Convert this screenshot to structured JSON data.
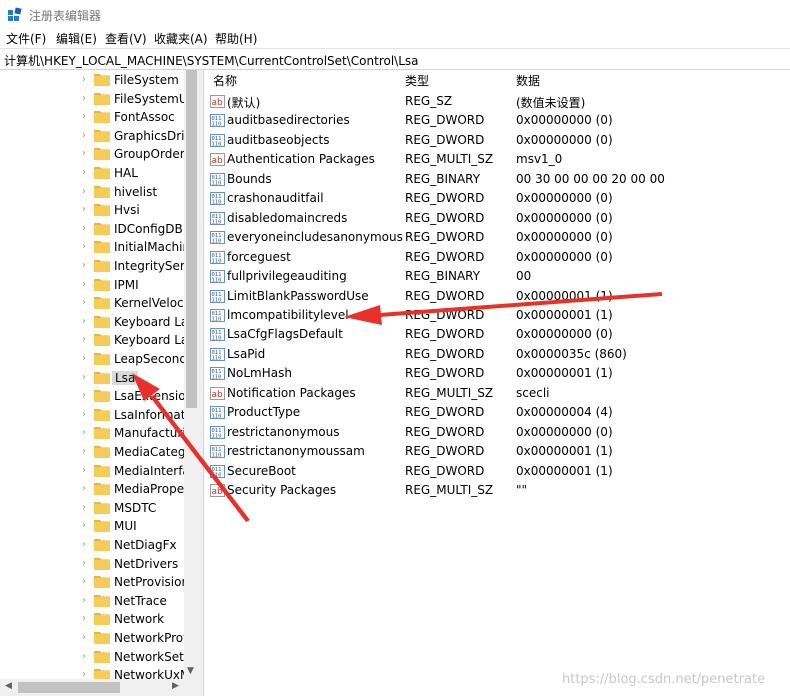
{
  "window": {
    "title": "注册表编辑器"
  },
  "menu": [
    "文件(F)",
    "编辑(E)",
    "查看(V)",
    "收藏夹(A)",
    "帮助(H)"
  ],
  "address": "计算机\\HKEY_LOCAL_MACHINE\\SYSTEM\\CurrentControlSet\\Control\\Lsa",
  "tree": {
    "items": [
      "FileSystem",
      "FileSystemUti",
      "FontAssoc",
      "GraphicsDrive",
      "GroupOrderL",
      "HAL",
      "hivelist",
      "Hvsi",
      "IDConfigDB",
      "InitialMachine",
      "IntegrityServi",
      "IPMI",
      "KernelVelocit",
      "Keyboard Lay",
      "Keyboard Lay",
      "LeapSecondI",
      "Lsa",
      "LsaExtension",
      "LsaInformati",
      "Manufacturi",
      "MediaCatego",
      "MediaInterfa",
      "MediaPropert",
      "MSDTC",
      "MUI",
      "NetDiagFx",
      "NetDrivers",
      "NetProvision",
      "NetTrace",
      "Network",
      "NetworkProv",
      "NetworkSetu",
      "NetworkUxM"
    ],
    "selected": "Lsa"
  },
  "columns": {
    "name": "名称",
    "type": "类型",
    "data": "数据"
  },
  "values": [
    {
      "name": "(默认)",
      "type": "REG_SZ",
      "data": "(数值未设置)",
      "icon": "string-value-icon"
    },
    {
      "name": "auditbasedirectories",
      "type": "REG_DWORD",
      "data": "0x00000000 (0)",
      "icon": "binary-value-icon"
    },
    {
      "name": "auditbaseobjects",
      "type": "REG_DWORD",
      "data": "0x00000000 (0)",
      "icon": "binary-value-icon"
    },
    {
      "name": "Authentication Packages",
      "type": "REG_MULTI_SZ",
      "data": "msv1_0",
      "icon": "string-value-icon"
    },
    {
      "name": "Bounds",
      "type": "REG_BINARY",
      "data": "00 30 00 00 00 20 00 00",
      "icon": "binary-value-icon"
    },
    {
      "name": "crashonauditfail",
      "type": "REG_DWORD",
      "data": "0x00000000 (0)",
      "icon": "binary-value-icon"
    },
    {
      "name": "disabledomaincreds",
      "type": "REG_DWORD",
      "data": "0x00000000 (0)",
      "icon": "binary-value-icon"
    },
    {
      "name": "everyoneincludesanonymous",
      "type": "REG_DWORD",
      "data": "0x00000000 (0)",
      "icon": "binary-value-icon"
    },
    {
      "name": "forceguest",
      "type": "REG_DWORD",
      "data": "0x00000000 (0)",
      "icon": "binary-value-icon"
    },
    {
      "name": "fullprivilegeauditing",
      "type": "REG_BINARY",
      "data": "00",
      "icon": "binary-value-icon"
    },
    {
      "name": "LimitBlankPasswordUse",
      "type": "REG_DWORD",
      "data": "0x00000001 (1)",
      "icon": "binary-value-icon"
    },
    {
      "name": "lmcompatibilitylevel",
      "type": "REG_DWORD",
      "data": "0x00000001 (1)",
      "icon": "binary-value-icon"
    },
    {
      "name": "LsaCfgFlagsDefault",
      "type": "REG_DWORD",
      "data": "0x00000000 (0)",
      "icon": "binary-value-icon"
    },
    {
      "name": "LsaPid",
      "type": "REG_DWORD",
      "data": "0x0000035c (860)",
      "icon": "binary-value-icon"
    },
    {
      "name": "NoLmHash",
      "type": "REG_DWORD",
      "data": "0x00000001 (1)",
      "icon": "binary-value-icon"
    },
    {
      "name": "Notification Packages",
      "type": "REG_MULTI_SZ",
      "data": "scecli",
      "icon": "string-value-icon"
    },
    {
      "name": "ProductType",
      "type": "REG_DWORD",
      "data": "0x00000004 (4)",
      "icon": "binary-value-icon"
    },
    {
      "name": "restrictanonymous",
      "type": "REG_DWORD",
      "data": "0x00000000 (0)",
      "icon": "binary-value-icon"
    },
    {
      "name": "restrictanonymoussam",
      "type": "REG_DWORD",
      "data": "0x00000001 (1)",
      "icon": "binary-value-icon"
    },
    {
      "name": "SecureBoot",
      "type": "REG_DWORD",
      "data": "0x00000001 (1)",
      "icon": "binary-value-icon"
    },
    {
      "name": "Security Packages",
      "type": "REG_MULTI_SZ",
      "data": "\"\"",
      "icon": "string-value-icon"
    }
  ],
  "watermark": "https://blog.csdn.net/penetrate",
  "colors": {
    "arrow": "#e8312a",
    "folder": "#f3c64b",
    "selection": "#d9d9d9"
  }
}
